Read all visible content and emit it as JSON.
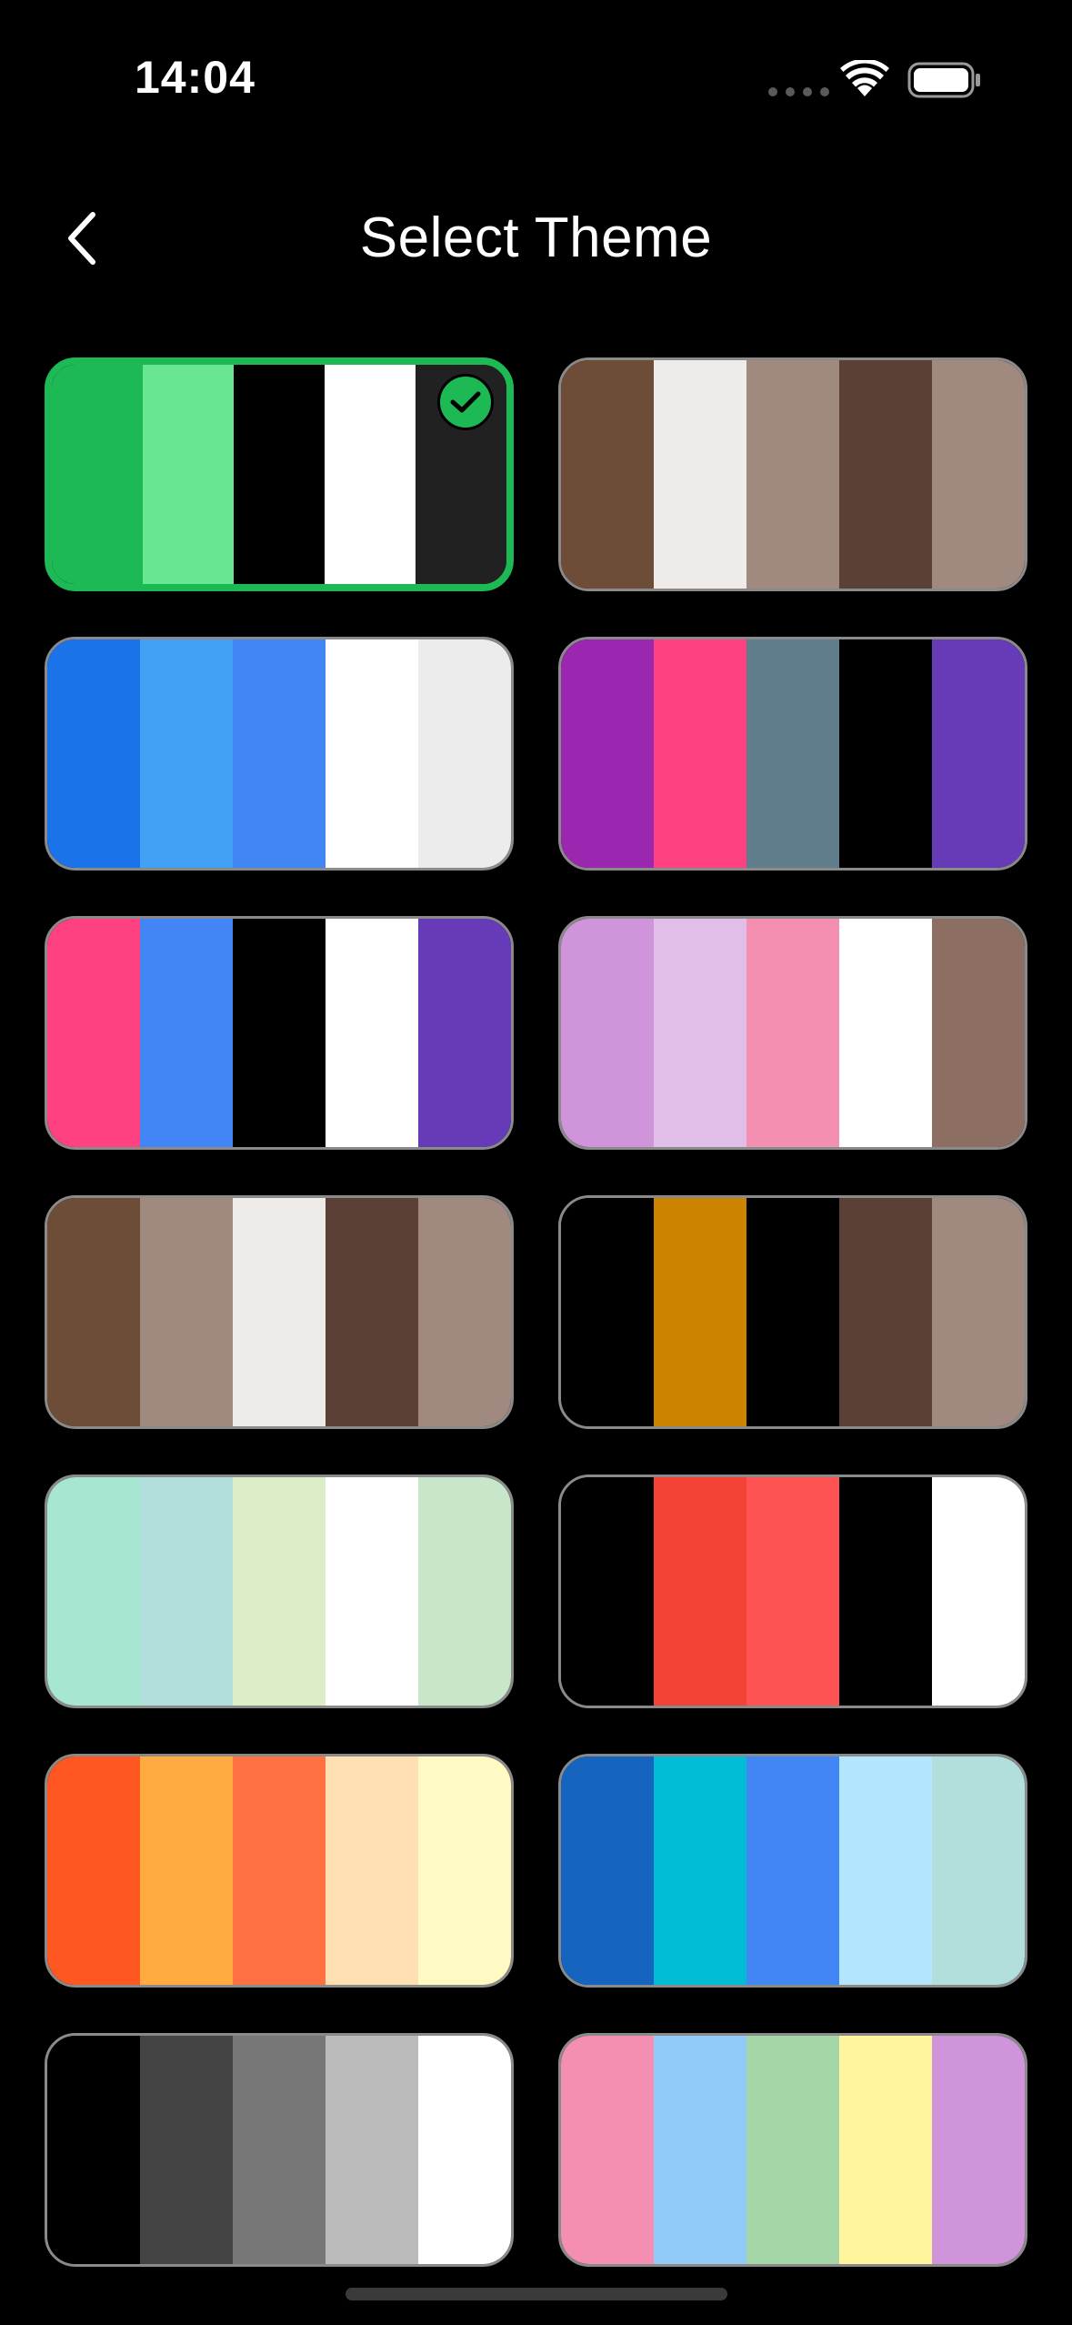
{
  "status_bar": {
    "time": "14:04",
    "icons": [
      "cellular-signal-icon",
      "wifi-icon",
      "battery-icon"
    ]
  },
  "header": {
    "title": "Select Theme",
    "back_icon": "chevron-left-icon"
  },
  "selected_index": 0,
  "accent_color": "#1DB954",
  "themes": [
    {
      "colors": [
        "#1DB954",
        "#69E692",
        "#000000",
        "#FFFFFF",
        "#212121"
      ]
    },
    {
      "colors": [
        "#6D4C38",
        "#EFEBE8",
        "#A08A80",
        "#5B4037",
        "#A08A80"
      ]
    },
    {
      "colors": [
        "#1A73E8",
        "#42A0F5",
        "#4286F5",
        "#FFFFFF",
        "#ECECEC"
      ]
    },
    {
      "colors": [
        "#9B27B0",
        "#FF4081",
        "#607D8B",
        "#000000",
        "#673AB7"
      ]
    },
    {
      "colors": [
        "#FF4081",
        "#4286F5",
        "#000000",
        "#FFFFFF",
        "#673AB7"
      ]
    },
    {
      "colors": [
        "#CF94DA",
        "#E1BEE7",
        "#F48FB1",
        "#FFFFFF",
        "#8C6E63"
      ]
    },
    {
      "colors": [
        "#6D4C38",
        "#A08A80",
        "#EFEBE8",
        "#5B4037",
        "#A08A80"
      ]
    },
    {
      "colors": [
        "#000000",
        "#CC8400",
        "#000000",
        "#5B4037",
        "#A08A80"
      ]
    },
    {
      "colors": [
        "#A7E6D1",
        "#B2DFDB",
        "#DCEDC8",
        "#FFFFFF",
        "#C8E6C9"
      ]
    },
    {
      "colors": [
        "#000000",
        "#F44336",
        "#FF5252",
        "#000000",
        "#FFFFFF"
      ]
    },
    {
      "colors": [
        "#FF5722",
        "#FFAB40",
        "#FF7043",
        "#FFE0B2",
        "#FFF9C4"
      ]
    },
    {
      "colors": [
        "#1565C0",
        "#00BCD4",
        "#4286F5",
        "#B3E5FC",
        "#B2DFDB"
      ]
    },
    {
      "colors": [
        "#000000",
        "#444444",
        "#777777",
        "#BBBBBB",
        "#FFFFFF"
      ]
    },
    {
      "colors": [
        "#F48FB1",
        "#90CAF9",
        "#A5D6A7",
        "#FFF59D",
        "#CF94DA"
      ]
    }
  ]
}
